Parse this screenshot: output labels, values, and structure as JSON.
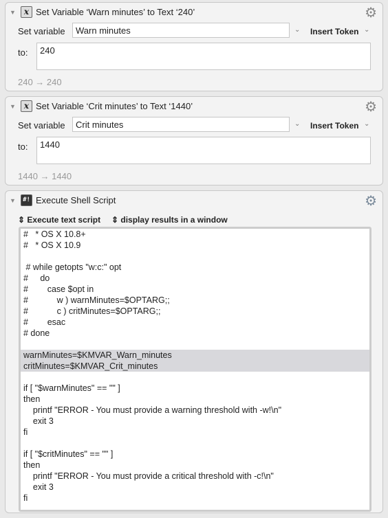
{
  "actions": [
    {
      "title": "Set Variable ‘Warn minutes’ to Text ‘240’",
      "set_variable_label": "Set variable",
      "variable": "Warn minutes",
      "insert_token": "Insert Token",
      "to_label": "to:",
      "value": "240",
      "result": "240 → 240"
    },
    {
      "title": "Set Variable ‘Crit minutes’ to Text ‘1440’",
      "set_variable_label": "Set variable",
      "variable": "Crit minutes",
      "insert_token": "Insert Token",
      "to_label": "to:",
      "value": "1440",
      "result": "1440 → 1440"
    }
  ],
  "shell": {
    "title": "Execute Shell Script",
    "mode": "Execute text script",
    "output": "display results in a window",
    "lines": [
      "#   * OS X 10.8+",
      "#   * OS X 10.9",
      "",
      " # while getopts \"w:c:\" opt",
      "#     do",
      "#        case $opt in",
      "#            w ) warnMinutes=$OPTARG;;",
      "#            c ) critMinutes=$OPTARG;;",
      "#        esac",
      "# done",
      "",
      "warnMinutes=$KMVAR_Warn_minutes",
      "critMinutes=$KMVAR_Crit_minutes",
      "",
      "if [ \"$warnMinutes\" == \"\" ]",
      "then",
      "    printf \"ERROR - You must provide a warning threshold with -w!\\n\"",
      "    exit 3",
      "fi",
      "",
      "if [ \"$critMinutes\" == \"\" ]",
      "then",
      "    printf \"ERROR - You must provide a critical threshold with -c!\\n\"",
      "    exit 3",
      "fi"
    ],
    "highlighted": [
      11,
      12
    ]
  }
}
